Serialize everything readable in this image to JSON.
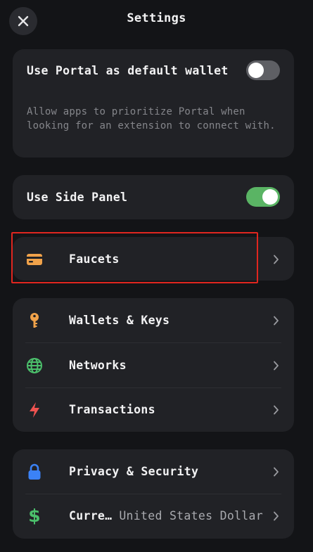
{
  "header": {
    "title": "Settings"
  },
  "default_wallet": {
    "label": "Use Portal as default wallet",
    "description": "Allow apps to prioritize Portal when looking for an extension to connect with.",
    "enabled": false
  },
  "side_panel": {
    "label": "Use Side Panel",
    "enabled": true
  },
  "faucets": {
    "label": "Faucets",
    "icon": "card-icon",
    "color": "#f0a24a"
  },
  "group1": {
    "items": [
      {
        "label": "Wallets & Keys",
        "icon": "key-icon",
        "color": "#f0a24a"
      },
      {
        "label": "Networks",
        "icon": "globe-icon",
        "color": "#4bbf6b"
      },
      {
        "label": "Transactions",
        "icon": "lightning-icon",
        "color": "#ef5350"
      }
    ]
  },
  "group2": {
    "items": [
      {
        "label": "Privacy & Security",
        "icon": "lock-icon",
        "color": "#3b82f6"
      },
      {
        "label": "Curre…",
        "value": "United States Dollar",
        "icon": "dollar-icon",
        "color": "#4bbf6b"
      }
    ]
  }
}
